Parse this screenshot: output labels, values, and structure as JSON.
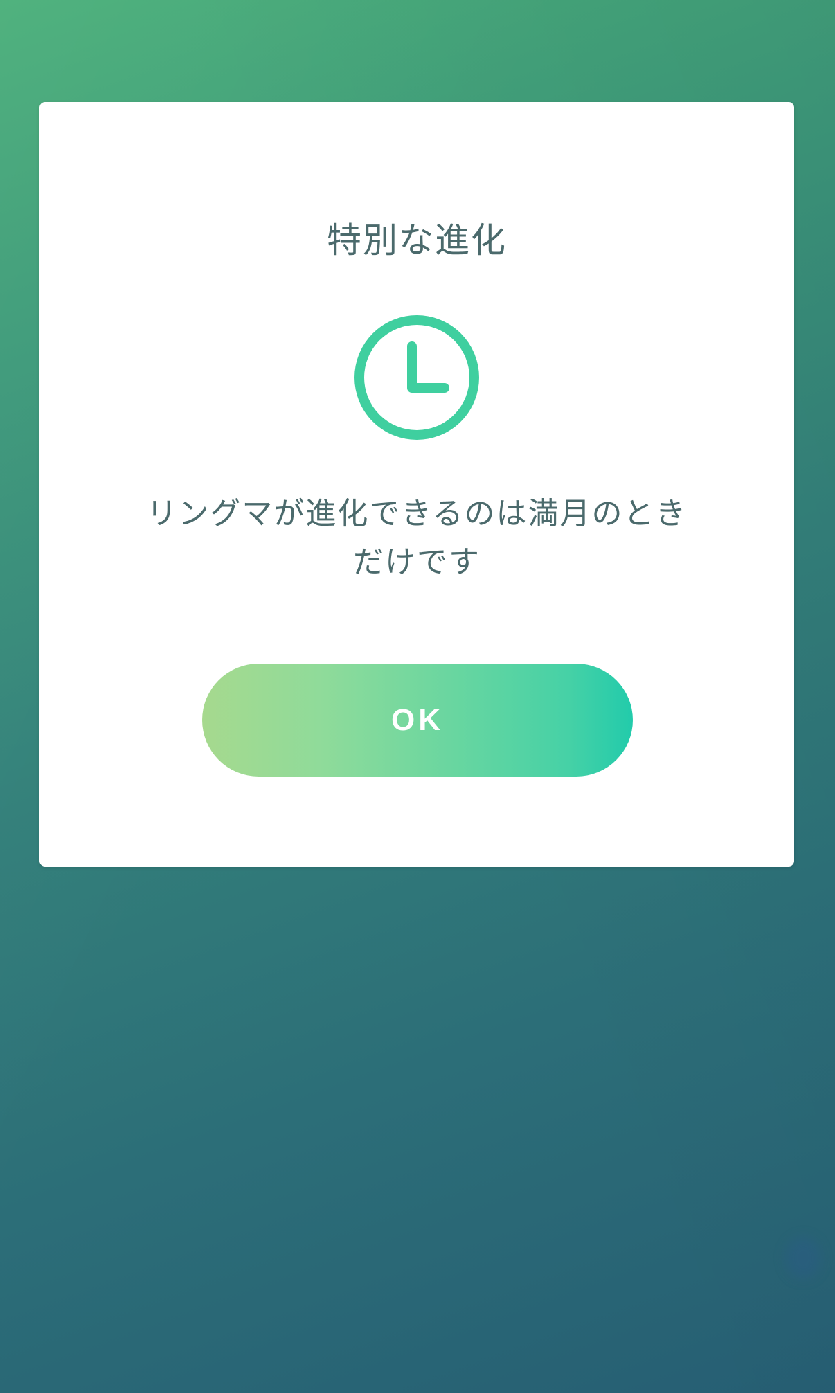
{
  "dialog": {
    "title": "特別な進化",
    "icon": "clock-icon",
    "message_line1": "リングマが進化できるのは満月のとき",
    "message_line2": "だけです",
    "ok_label": "OK"
  },
  "colors": {
    "accent": "#3fcf9f",
    "text": "#4b6a6c",
    "button_start": "#a6d98e",
    "button_end": "#22cbab"
  }
}
